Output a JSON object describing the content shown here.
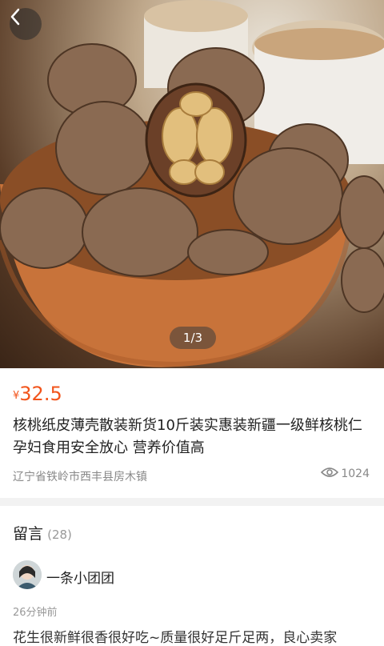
{
  "hero": {
    "pager": "1/3"
  },
  "product": {
    "currency": "¥",
    "price": "32.5",
    "title": "核桃纸皮薄壳散装新货10斤装实惠装新疆一级鲜核桃仁孕妇食用安全放心 营养价值高",
    "location": "辽宁省铁岭市西丰县房木镇",
    "views": "1024"
  },
  "comments": {
    "title": "留言",
    "count": "(28)",
    "items": [
      {
        "user": "一条小团团",
        "time": "26分钟前",
        "text": "花生很新鲜很香很好吃~质量很好足斤足两，良心卖家"
      }
    ]
  },
  "colors": {
    "price": "#f2541b",
    "muted": "#888888"
  },
  "icons": {
    "back": "chevron-left-icon",
    "views": "eye-icon"
  }
}
